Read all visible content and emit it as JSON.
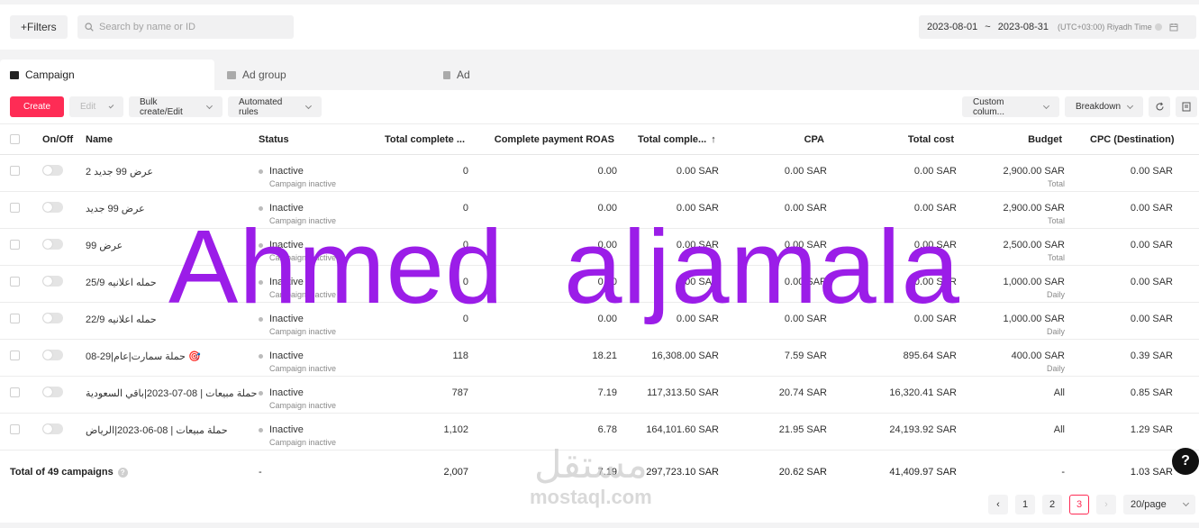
{
  "topbar": {
    "filters_label": "Filters",
    "search_placeholder": "Search by name or ID",
    "date_start": "2023-08-01",
    "date_sep": "~",
    "date_end": "2023-08-31",
    "timezone": "(UTC+03:00) Riyadh Time"
  },
  "tabs": [
    {
      "label": "Campaign"
    },
    {
      "label": "Ad group"
    },
    {
      "label": "Ad"
    }
  ],
  "toolbar": {
    "create": "Create",
    "edit": "Edit",
    "bulk": "Bulk create/Edit",
    "rules": "Automated rules",
    "custom_columns": "Custom colum...",
    "breakdown": "Breakdown"
  },
  "columns": {
    "onoff": "On/Off",
    "name": "Name",
    "status": "Status",
    "total_complete": "Total complete ...",
    "roas": "Complete payment ROAS",
    "total_complete_value": "Total comple...",
    "cpa": "CPA",
    "total_cost": "Total cost",
    "budget": "Budget",
    "cpc": "CPC (Destination)"
  },
  "rows": [
    {
      "name": "عرض 99 جديد 2",
      "status": "Inactive",
      "status_sub": "Campaign inactive",
      "total_complete": "0",
      "roas": "0.00",
      "value": "0.00 SAR",
      "cpa": "0.00 SAR",
      "cost": "0.00 SAR",
      "budget": "2,900.00 SAR",
      "budget_sub": "Total",
      "cpc": "0.00 SAR"
    },
    {
      "name": "عرض 99 جديد",
      "status": "Inactive",
      "status_sub": "Campaign inactive",
      "total_complete": "0",
      "roas": "0.00",
      "value": "0.00 SAR",
      "cpa": "0.00 SAR",
      "cost": "0.00 SAR",
      "budget": "2,900.00 SAR",
      "budget_sub": "Total",
      "cpc": "0.00 SAR"
    },
    {
      "name": "عرض 99",
      "status": "Inactive",
      "status_sub": "Campaign inactive",
      "total_complete": "0",
      "roas": "0.00",
      "value": "0.00 SAR",
      "cpa": "0.00 SAR",
      "cost": "0.00 SAR",
      "budget": "2,500.00 SAR",
      "budget_sub": "Total",
      "cpc": "0.00 SAR"
    },
    {
      "name": "حمله اعلانيه 25/9",
      "status": "Inactive",
      "status_sub": "Campaign inactive",
      "total_complete": "0",
      "roas": "0.00",
      "value": "0.00 SAR",
      "cpa": "0.00 SAR",
      "cost": "0.00 SAR",
      "budget": "1,000.00 SAR",
      "budget_sub": "Daily",
      "cpc": "0.00 SAR"
    },
    {
      "name": "حمله اعلانيه 22/9",
      "status": "Inactive",
      "status_sub": "Campaign inactive",
      "total_complete": "0",
      "roas": "0.00",
      "value": "0.00 SAR",
      "cpa": "0.00 SAR",
      "cost": "0.00 SAR",
      "budget": "1,000.00 SAR",
      "budget_sub": "Daily",
      "cpc": "0.00 SAR"
    },
    {
      "name": "حملة سمارت|عام|29-08 🎯",
      "status": "Inactive",
      "status_sub": "Campaign inactive",
      "total_complete": "118",
      "roas": "18.21",
      "value": "16,308.00 SAR",
      "cpa": "7.59 SAR",
      "cost": "895.64 SAR",
      "budget": "400.00 SAR",
      "budget_sub": "Daily",
      "cpc": "0.39 SAR"
    },
    {
      "name": "حملة مبيعات | 08-07-2023|باقي السعودية",
      "status": "Inactive",
      "status_sub": "Campaign inactive",
      "total_complete": "787",
      "roas": "7.19",
      "value": "117,313.50 SAR",
      "cpa": "20.74 SAR",
      "cost": "16,320.41 SAR",
      "budget": "All",
      "budget_sub": "",
      "cpc": "0.85 SAR"
    },
    {
      "name": "حملة مبيعات | 08-06-2023|الرياض",
      "status": "Inactive",
      "status_sub": "Campaign inactive",
      "total_complete": "1,102",
      "roas": "6.78",
      "value": "164,101.60 SAR",
      "cpa": "21.95 SAR",
      "cost": "24,193.92 SAR",
      "budget": "All",
      "budget_sub": "",
      "cpc": "1.29 SAR"
    }
  ],
  "total": {
    "label": "Total of 49 campaigns",
    "status": "-",
    "total_complete": "2,007",
    "roas": "7.19",
    "value": "297,723.10 SAR",
    "cpa": "20.62 SAR",
    "cost": "41,409.97 SAR",
    "budget": "-",
    "cpc": "1.03 SAR"
  },
  "pagination": {
    "pages": [
      "1",
      "2",
      "3"
    ],
    "current": "3",
    "page_size": "20/page"
  },
  "watermark": "Ahmed  aljamala",
  "logo": {
    "arabic": "مستقل",
    "latin": "mostaql.com"
  },
  "help_label": "?"
}
